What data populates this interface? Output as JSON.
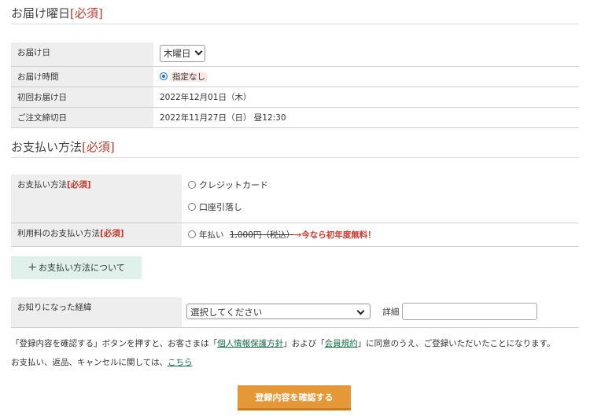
{
  "delivery": {
    "title": "お届け曜日",
    "required": "[必須]",
    "rows": {
      "day": {
        "label": "お届け日",
        "value": "木曜日"
      },
      "time": {
        "label": "お届け時間",
        "value": "指定なし"
      },
      "first": {
        "label": "初回お届け日",
        "value": "2022年12月01日（木）"
      },
      "deadline": {
        "label": "ご注文締切日",
        "value": "2022年11月27日（日） 昼12:30"
      }
    }
  },
  "payment": {
    "title": "お支払い方法",
    "required": "[必須]",
    "method_label": "お支払い方法",
    "method_required": "[必須]",
    "options": [
      "クレジットカード",
      "口座引落し"
    ],
    "fee_label": "利用料のお支払い方法",
    "fee_required": "[必須]",
    "fee_option": "年払い",
    "fee_strike": "1,000円（税込）",
    "fee_promo": "→今なら初年度無料！",
    "about_button": "お支払い方法について"
  },
  "referral": {
    "label": "お知りになった経緯",
    "select_value": "選択してください",
    "detail_label": "詳細"
  },
  "notes": {
    "line1_a": "「登録内容を確認する」ボタンを押すと、お客さまは「",
    "privacy_link": "個人情報保護方針",
    "line1_b": "」および「",
    "terms_link": "会員規約",
    "line1_c": "」に同意のうえ、ご登録いただいたことになります。",
    "line2": "お支払い、返品、キャンセルに関しては、",
    "here_link": "こちら"
  },
  "confirm_button": "登録内容を確認する",
  "colors": {
    "accent": "#e59837",
    "required": "#c0392b",
    "link": "#1a6c4a",
    "about_bg": "#dff1ea"
  }
}
